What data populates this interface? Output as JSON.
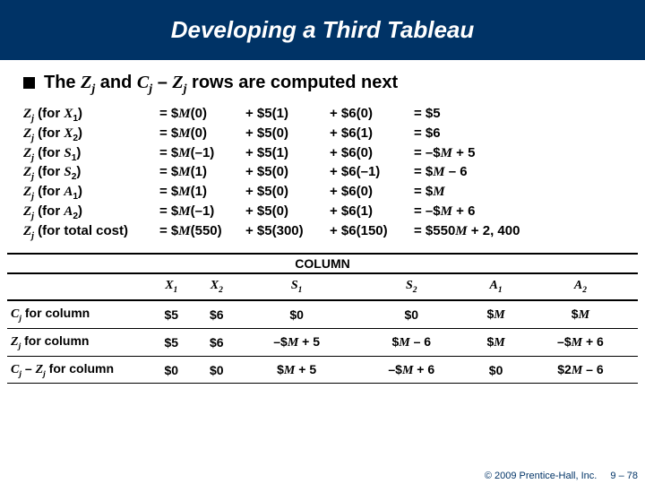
{
  "title": "Developing a Third Tableau",
  "bullet": {
    "pre": "The ",
    "z": "Z",
    "zsub": "j",
    "mid1": " and ",
    "c": "C",
    "csub": "j",
    "mid2": " – ",
    "z2": "Z",
    "z2sub": "j",
    "post": " rows are computed next"
  },
  "eq": {
    "rows": [
      {
        "c1a": "Z",
        "c1s": "j",
        "c1p": "(for ",
        "c1v": "X",
        "c1vs": "1",
        "c1e": ")",
        "c2a": "= $",
        "c2m": "M",
        "c2b": "(0)",
        "c3": "+ $5(1)",
        "c4": "+ $6(0)",
        "c5": "= $5"
      },
      {
        "c1a": "Z",
        "c1s": "j",
        "c1p": "(for ",
        "c1v": "X",
        "c1vs": "2",
        "c1e": ")",
        "c2a": "= $",
        "c2m": "M",
        "c2b": "(0)",
        "c3": "+ $5(0)",
        "c4": "+ $6(1)",
        "c5": "= $6"
      },
      {
        "c1a": "Z",
        "c1s": "j",
        "c1p": "(for ",
        "c1v": "S",
        "c1vs": "1",
        "c1e": ")",
        "c2a": "= $",
        "c2m": "M",
        "c2b": "(–1)",
        "c3": "+ $5(1)",
        "c4": "+ $6(0)",
        "c5a": "= –$",
        "c5m": "M",
        "c5b": " + 5"
      },
      {
        "c1a": "Z",
        "c1s": "j",
        "c1p": "(for ",
        "c1v": "S",
        "c1vs": "2",
        "c1e": ")",
        "c2a": "= $",
        "c2m": "M",
        "c2b": "(1)",
        "c3": "+ $5(0)",
        "c4": "+ $6(–1)",
        "c5a": "= $",
        "c5m": "M",
        "c5b": " – 6"
      },
      {
        "c1a": "Z",
        "c1s": "j",
        "c1p": "(for ",
        "c1v": "A",
        "c1vs": "1",
        "c1e": ")",
        "c2a": "= $",
        "c2m": "M",
        "c2b": "(1)",
        "c3": "+ $5(0)",
        "c4": "+ $6(0)",
        "c5a": "= $",
        "c5m": "M",
        "c5b": ""
      },
      {
        "c1a": "Z",
        "c1s": "j",
        "c1p": "(for ",
        "c1v": "A",
        "c1vs": "2",
        "c1e": ")",
        "c2a": "= $",
        "c2m": "M",
        "c2b": "(–1)",
        "c3": "+ $5(0)",
        "c4": "+ $6(1)",
        "c5a": "= –$",
        "c5m": "M",
        "c5b": " + 6"
      },
      {
        "c1a": "Z",
        "c1s": "j",
        "c1p": "(for total cost)",
        "c1v": "",
        "c1vs": "",
        "c1e": "",
        "c2a": "= $",
        "c2m": "M",
        "c2b": "(550)",
        "c3": "+ $5(300)",
        "c4": "+ $6(150)",
        "c5a": "= $550",
        "c5m": "M",
        "c5b": " + 2, 400"
      }
    ]
  },
  "table": {
    "column_header": "COLUMN",
    "head": {
      "rowh": "",
      "x1": "X",
      "x1s": "1",
      "x2": "X",
      "x2s": "2",
      "s1": "S",
      "s1s": "1",
      "s2": "S",
      "s2s": "2",
      "a1": "A",
      "a1s": "1",
      "a2": "A",
      "a2s": "2"
    },
    "rows": [
      {
        "h_a": "C",
        "h_s": "j",
        "h_t": " for column",
        "x1": "$5",
        "x2": "$6",
        "s1": "$0",
        "s2": "$0",
        "a1a": "$",
        "a1m": "M",
        "a1b": "",
        "a2a": "$",
        "a2m": "M",
        "a2b": ""
      },
      {
        "h_a": "Z",
        "h_s": "j",
        "h_t": " for column",
        "x1": "$5",
        "x2": "$6",
        "s1a": "–$",
        "s1m": "M",
        "s1b": " + 5",
        "s2a": "$",
        "s2m": "M",
        "s2b": " – 6",
        "a1a": "$",
        "a1m": "M",
        "a1b": "",
        "a2a": "–$",
        "a2m": "M",
        "a2b": " + 6"
      },
      {
        "h_a": "C",
        "h_s": "j",
        "h_mid": " – ",
        "h_a2": "Z",
        "h_s2": "j",
        "h_t": " for column",
        "x1": "$0",
        "x2": "$0",
        "s1a": "$",
        "s1m": "M",
        "s1b": " + 5",
        "s2a": "–$",
        "s2m": "M",
        "s2b": " + 6",
        "a1": "$0",
        "a2a": "$2",
        "a2m": "M",
        "a2b": " – 6"
      }
    ]
  },
  "footer": {
    "copy": "© 2009 Prentice-Hall, Inc.",
    "page": "9 – 78"
  }
}
